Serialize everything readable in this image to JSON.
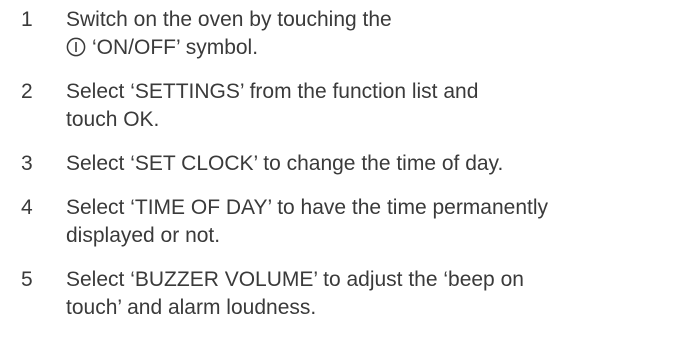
{
  "steps": [
    {
      "number": "1",
      "line1": "Switch on the oven by touching the",
      "line2_text": "‘ON/OFF’ symbol.",
      "icon": "power-icon"
    },
    {
      "number": "2",
      "line1": "Select ‘SETTINGS’ from the function list and",
      "line2": "touch OK."
    },
    {
      "number": "3",
      "line1": "Select ‘SET CLOCK’ to change the time of day."
    },
    {
      "number": "4",
      "line1": "Select ‘TIME OF DAY’ to have the time permanently",
      "line2": "displayed or not."
    },
    {
      "number": "5",
      "line1": "Select ‘BUZZER VOLUME’ to adjust the ‘beep on",
      "line2": "touch’ and alarm loudness."
    }
  ]
}
